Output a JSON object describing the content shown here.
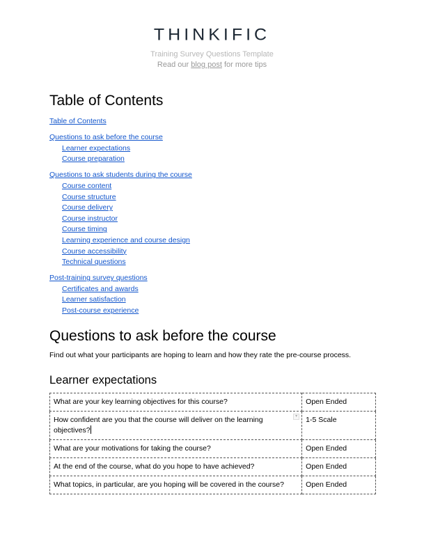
{
  "header": {
    "logo": "THINKIFIC",
    "subtitle": "Training Survey Questions Template",
    "tip_prefix": "Read our ",
    "tip_link": "blog post",
    "tip_suffix": " for more tips"
  },
  "toc": {
    "title": "Table of Contents",
    "entries": [
      {
        "label": "Table of Contents",
        "level": 1
      },
      {
        "label": "Questions to ask before the course",
        "level": 1
      },
      {
        "label": "Learner expectations",
        "level": 2
      },
      {
        "label": "Course preparation",
        "level": 2
      },
      {
        "label": "Questions to ask students during the course",
        "level": 1
      },
      {
        "label": "Course content",
        "level": 2
      },
      {
        "label": "Course structure",
        "level": 2
      },
      {
        "label": "Course delivery",
        "level": 2
      },
      {
        "label": "Course instructor",
        "level": 2
      },
      {
        "label": "Course timing",
        "level": 2
      },
      {
        "label": "Learning experience and course design",
        "level": 2
      },
      {
        "label": "Course accessibility",
        "level": 2
      },
      {
        "label": "Technical questions",
        "level": 2
      },
      {
        "label": "Post-training survey questions",
        "level": 1
      },
      {
        "label": "Certificates and awards",
        "level": 2
      },
      {
        "label": "Learner satisfaction",
        "level": 2
      },
      {
        "label": "Post-course experience",
        "level": 2
      }
    ]
  },
  "section": {
    "title": "Questions to ask before the course",
    "intro": "Find out what your participants are hoping to learn and how they rate the pre-course process.",
    "subsection": {
      "title": "Learner expectations",
      "rows": [
        {
          "question": "What are your key learning objectives for this course?",
          "type": "Open Ended"
        },
        {
          "question": "How confident are you that the course will deliver on the learning objectives?",
          "type": "1-5 Scale"
        },
        {
          "question": "What are your motivations for taking the course?",
          "type": "Open Ended"
        },
        {
          "question": "At the end of the course, what do you hope to have achieved?",
          "type": "Open Ended"
        },
        {
          "question": "What topics, in particular, are you hoping will be covered in the course?",
          "type": "Open Ended"
        }
      ]
    }
  },
  "icons": {
    "cell_dropdown": "chevron-down-icon"
  }
}
